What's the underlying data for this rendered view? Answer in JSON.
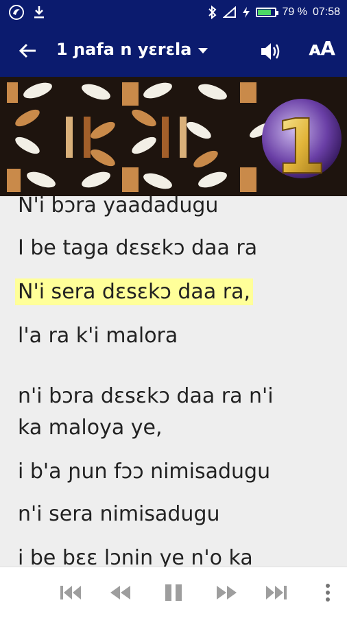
{
  "status": {
    "battery_percent": "79 %",
    "time": "07:58",
    "battery_level": 0.79
  },
  "appbar": {
    "title": "1 ɲafa n yɛrɛla",
    "font_button_label": "ᴀA"
  },
  "banner": {
    "track_number": "1"
  },
  "lyrics": {
    "lines": [
      "N'i bɔra yaadadugu",
      "I be taga dɛsɛkɔ daa ra",
      "N'i sera dɛsɛkɔ daa ra,",
      "l'a ra k'i malora",
      "n'i bɔra dɛsɛkɔ daa ra n'i",
      "ka maloya ye,",
      "i b'a ɲun fɔɔ nimisadugu",
      "n'i sera nimisadugu",
      "i be bɛɛ lɔnin ye n'o ka"
    ],
    "highlighted_index": 2
  },
  "colors": {
    "bar": "#0b1b6e",
    "highlight": "#ffff99"
  }
}
